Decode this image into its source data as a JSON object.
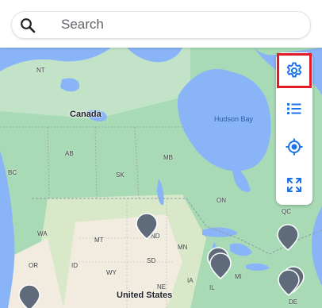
{
  "search": {
    "placeholder": "Search"
  },
  "controls": [
    {
      "name": "settings",
      "icon": "gear-icon",
      "selected": true
    },
    {
      "name": "list",
      "icon": "list-icon",
      "selected": false
    },
    {
      "name": "locate",
      "icon": "my-location-icon",
      "selected": false
    },
    {
      "name": "expand",
      "icon": "fullscreen-icon",
      "selected": false
    }
  ],
  "map": {
    "labels": {
      "canada": "Canada",
      "united_states": "United States",
      "hudson_bay": "Hudson Bay",
      "nt": "NT",
      "ab": "AB",
      "bc": "BC",
      "sk": "SK",
      "mb": "MB",
      "on": "ON",
      "qc": "QC",
      "nd": "ND",
      "mt": "MT",
      "sd": "SD",
      "mn": "MN",
      "wy": "WY",
      "mi": "MI",
      "il": "IL",
      "ia": "IA",
      "ne": "NE",
      "de": "DE",
      "id": "ID",
      "wa": "WA",
      "or": "OR"
    }
  },
  "colors": {
    "accent": "#1a73e8",
    "selection_outline": "#e01b24",
    "land_green": "#a8dab5",
    "land_dry": "#f1ecdf",
    "water": "#8ab4f8",
    "pin": "#5f6b7a"
  }
}
